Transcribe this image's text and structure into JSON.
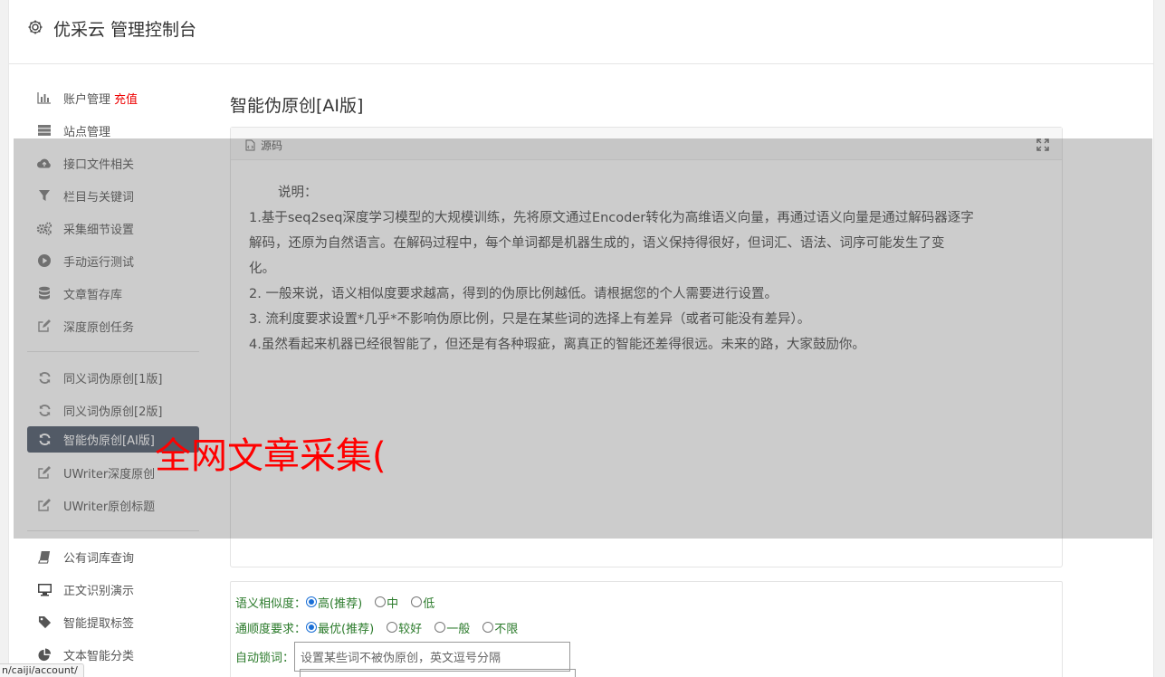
{
  "header": {
    "title": "优采云 管理控制台",
    "icon": "gear-icon"
  },
  "sidebar": {
    "group1": [
      {
        "label": "账户管理",
        "badge": "充值",
        "icon": "bar-chart-icon"
      },
      {
        "label": "站点管理",
        "icon": "server-icon"
      },
      {
        "label": "接口文件相关",
        "icon": "cloud-upload-icon"
      },
      {
        "label": "栏目与关键词",
        "icon": "filter-icon"
      },
      {
        "label": "采集细节设置",
        "icon": "gears-icon"
      },
      {
        "label": "手动运行测试",
        "icon": "play-circle-icon"
      },
      {
        "label": "文章暂存库",
        "icon": "database-icon"
      },
      {
        "label": "深度原创任务",
        "icon": "edit-icon"
      }
    ],
    "group2": [
      {
        "label": "同义词伪原创[1版]",
        "icon": "refresh-icon"
      },
      {
        "label": "同义词伪原创[2版]",
        "icon": "refresh-icon"
      },
      {
        "label": "智能伪原创[AI版]",
        "icon": "refresh-icon",
        "active": true
      },
      {
        "label": "UWriter深度原创",
        "icon": "edit-icon"
      },
      {
        "label": "UWriter原创标题",
        "icon": "edit-icon"
      }
    ],
    "group3": [
      {
        "label": "公有词库查询",
        "icon": "book-icon"
      },
      {
        "label": "正文识别演示",
        "icon": "monitor-icon"
      },
      {
        "label": "智能提取标签",
        "icon": "tag-icon"
      },
      {
        "label": "文本智能分类",
        "icon": "pie-chart-icon"
      }
    ]
  },
  "main": {
    "title": "智能伪原创[AI版]",
    "editor": {
      "source_label": "源码",
      "intro": "说明：",
      "lines": [
        "1.基于seq2seq深度学习模型的大规模训练，先将原文通过Encoder转化为高维语义向量，再通过语义向量是通过解码器逐字",
        "解码，还原为自然语言。在解码过程中，每个单词都是机器生成的，语义保持得很好，但词汇、语法、词序可能发生了变",
        "化。",
        "2. 一般来说，语义相似度要求越高，得到的伪原比例越低。请根据您的个人需要进行设置。",
        "3. 流利度要求设置*几乎*不影响伪原比例，只是在某些词的选择上有差异（或者可能没有差异）。",
        "4.虽然看起来机器已经很智能了，但还是有各种瑕疵，离真正的智能还差得很远。未来的路，大家鼓励你。"
      ]
    },
    "settings": {
      "similarity": {
        "label": "语义相似度：",
        "options": [
          "高(推荐)",
          "中",
          "低"
        ],
        "selected": 0
      },
      "fluency": {
        "label": "通顺度要求：",
        "options": [
          "最优(推荐)",
          "较好",
          "一般",
          "不限"
        ],
        "selected": 0
      },
      "lock": {
        "label": "自动锁词：",
        "placeholder": "设置某些词不被伪原创，英文逗号分隔"
      }
    }
  },
  "watermark": "全网文章采集(",
  "statusbar": {
    "url": "n/caiji/account/"
  },
  "colors": {
    "accent": "#4a5568",
    "badge": "#e00000",
    "settings_label": "#2a7a2a",
    "watermark": "#ff0000"
  }
}
